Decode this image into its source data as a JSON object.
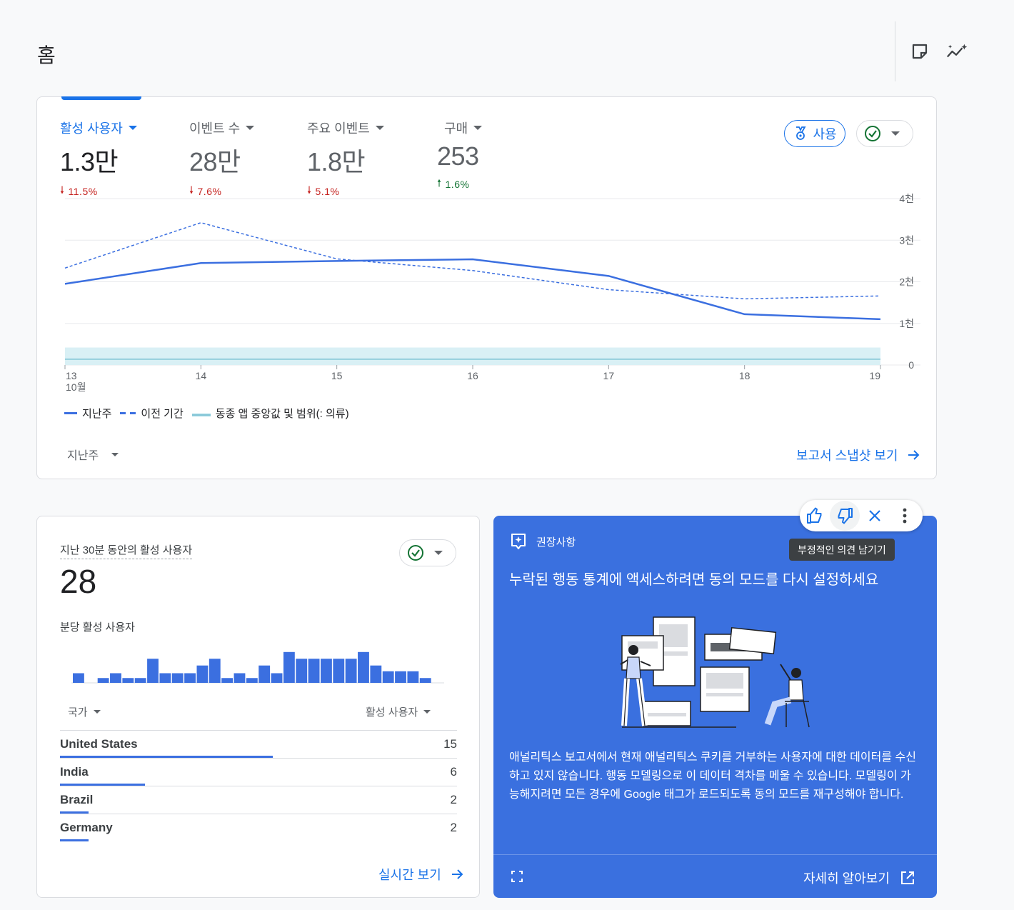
{
  "page": {
    "title": "홈"
  },
  "top_icons": [
    "notes-icon",
    "insights-icon"
  ],
  "main_card": {
    "metrics": [
      {
        "label": "활성 사용자",
        "value": "1.3만",
        "change": "11.5%",
        "direction": "down",
        "active": true
      },
      {
        "label": "이벤트 수",
        "value": "28만",
        "change": "7.6%",
        "direction": "down",
        "active": false
      },
      {
        "label": "주요 이벤트",
        "value": "1.8만",
        "change": "5.1%",
        "direction": "down",
        "active": false
      },
      {
        "label": "구매",
        "value": "253",
        "change": "1.6%",
        "direction": "up",
        "active": false
      }
    ],
    "use_button": "사용",
    "legend": {
      "current": "지난주",
      "previous": "이전 기간",
      "benchmark": "동종 앱 중앙값 및 범위(: 의류)"
    },
    "period_dropdown": "지난주",
    "snapshot_link": "보고서 스냅샷 보기"
  },
  "chart_data": {
    "type": "line",
    "x": [
      "13",
      "14",
      "15",
      "16",
      "17",
      "18",
      "19"
    ],
    "x_sublabel": "10월",
    "y_ticks": [
      "0",
      "1천",
      "2천",
      "3천",
      "4천"
    ],
    "ylim": [
      0,
      4000
    ],
    "grid": true,
    "series": [
      {
        "name": "지난주",
        "style": "solid",
        "values": [
          1950,
          2450,
          2500,
          2540,
          2140,
          1220,
          1100
        ]
      },
      {
        "name": "이전 기간",
        "style": "dashed",
        "values": [
          2330,
          3420,
          2550,
          2270,
          1810,
          1590,
          1660
        ]
      },
      {
        "name": "동종 앱 중앙값 및 범위(: 의류)",
        "style": "band",
        "median": 140,
        "range": [
          0,
          420
        ]
      }
    ],
    "colors": {
      "series": "#3b6fe0",
      "band": "#d9f0f5",
      "median": "#7cc2d4"
    }
  },
  "realtime_card": {
    "title": "지난 30분 동안의 활성 사용자",
    "value": "28",
    "subtitle": "분당 활성 사용자",
    "minute_bars": [
      1,
      0,
      0.5,
      1,
      0.5,
      0.5,
      2.5,
      1,
      1,
      1,
      1.8,
      2.5,
      0.5,
      1,
      0.5,
      1.8,
      1,
      3.2,
      2.5,
      2.5,
      2.5,
      2.5,
      2.5,
      3.2,
      1.8,
      1.2,
      1.2,
      1.2,
      0.5,
      0
    ],
    "col_country": "국가",
    "col_users": "활성 사용자",
    "rows": [
      {
        "country": "United States",
        "users": "15",
        "share": 15
      },
      {
        "country": "India",
        "users": "6",
        "share": 6
      },
      {
        "country": "Brazil",
        "users": "2",
        "share": 2
      },
      {
        "country": "Germany",
        "users": "2",
        "share": 2
      }
    ],
    "link": "실시간 보기"
  },
  "recommendation_card": {
    "tag": "권장사항",
    "title": "누락된 행동 통계에 액세스하려면 동의 모드를 다시 설정하세요",
    "body": "애널리틱스 보고서에서 현재 애널리틱스 쿠키를 거부하는 사용자에 대한 데이터를 수신하고 있지 않습니다. 행동 모델링으로 이 데이터 격차를 메울 수 있습니다. 모델링이 가능해지려면 모든 경우에 Google 태그가 로드되도록 동의 모드를 재구성해야 합니다.",
    "link": "자세히 알아보기",
    "tooltip": "부정적인 의견 남기기",
    "accent": "#3a70df"
  }
}
